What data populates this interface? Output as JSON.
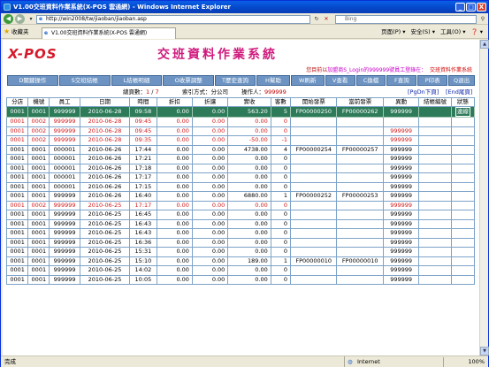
{
  "window": {
    "title": "V1.00交班資料作業系統(X-POS 雲通網) - Windows Internet Explorer"
  },
  "title_buttons": {
    "min": "_",
    "max": "□",
    "close": "X"
  },
  "address": {
    "url": "http://win2008/tw/jiaoban/jiaoban.asp",
    "search_text": "Bing"
  },
  "favorites": {
    "label": "收藏夹",
    "tab_title": "V1.00交班資料作業系統(X-POS 雲通網)",
    "commands": [
      "页面(P) ▾",
      "安全(S) ▾",
      "工具(O) ▾",
      "❓ ▾"
    ]
  },
  "app": {
    "logo": "X-POS",
    "title": "交班資料作業系統",
    "user_prefix": "您目前以",
    "user_name": "加盟商S_Login的999999號員工登錄在：",
    "user_function": "交班資料作業系統"
  },
  "menu": [
    "D關鍵操作",
    "S交班結帳",
    "L結帳明細",
    "O收票調整",
    "T歷史查詢",
    "H幫助",
    "W刷新",
    "V查看",
    "C換檔",
    "F查詢",
    "P印表",
    "Q退出"
  ],
  "info": {
    "pages_label": "總頁數：",
    "page_current": "1",
    "page_total": "7",
    "method_label": "索引方式：分公司",
    "operator_label": "操作人：",
    "operator_value": "999999",
    "pgdn": "[PgDn下頁]",
    "end": "[End尾頁]"
  },
  "table": {
    "headers": [
      "分店",
      "機號",
      "員工",
      "日期",
      "時間",
      "折扣",
      "折讓",
      "實收",
      "客數",
      "開始發票",
      "當前發票",
      "異動",
      "結帳編號",
      "狀態"
    ],
    "rows": [
      [
        "0001",
        "0001",
        "999999",
        "2010-06-28",
        "09:58",
        "0.00",
        "0.00",
        "563.20",
        "5",
        "FP00000250",
        "FP00000262",
        "999999",
        "",
        "連線"
      ],
      [
        "0001",
        "0002",
        "999999",
        "2010-06-28",
        "09:45",
        "0.00",
        "0.00",
        "0.00",
        "0",
        "",
        "",
        "",
        "",
        ""
      ],
      [
        "0001",
        "0002",
        "999999",
        "2010-06-28",
        "09:45",
        "0.00",
        "0.00",
        "0.00",
        "0",
        "",
        "",
        "999999",
        "",
        ""
      ],
      [
        "0001",
        "0002",
        "999999",
        "2010-06-28",
        "09:35",
        "0.00",
        "0.00",
        "-50.00",
        "-1",
        "",
        "",
        "999999",
        "",
        ""
      ],
      [
        "0001",
        "0001",
        "000001",
        "2010-06-26",
        "17:44",
        "0.00",
        "0.00",
        "4738.00",
        "4",
        "FP00000254",
        "FP00000257",
        "999999",
        "",
        ""
      ],
      [
        "0001",
        "0001",
        "000001",
        "2010-06-26",
        "17:21",
        "0.00",
        "0.00",
        "0.00",
        "0",
        "",
        "",
        "999999",
        "",
        ""
      ],
      [
        "0001",
        "0001",
        "000001",
        "2010-06-26",
        "17:18",
        "0.00",
        "0.00",
        "0.00",
        "0",
        "",
        "",
        "999999",
        "",
        ""
      ],
      [
        "0001",
        "0001",
        "000001",
        "2010-06-26",
        "17:17",
        "0.00",
        "0.00",
        "0.00",
        "0",
        "",
        "",
        "999999",
        "",
        ""
      ],
      [
        "0001",
        "0001",
        "000001",
        "2010-06-26",
        "17:15",
        "0.00",
        "0.00",
        "0.00",
        "0",
        "",
        "",
        "999999",
        "",
        ""
      ],
      [
        "0001",
        "0001",
        "999999",
        "2010-06-26",
        "16:40",
        "0.00",
        "0.00",
        "6880.00",
        "1",
        "FP00000252",
        "FP00000253",
        "999999",
        "",
        ""
      ],
      [
        "0001",
        "0002",
        "999999",
        "2010-06-25",
        "17:17",
        "0.00",
        "0.00",
        "0.00",
        "0",
        "",
        "",
        "999999",
        "",
        ""
      ],
      [
        "0001",
        "0001",
        "999999",
        "2010-06-25",
        "16:45",
        "0.00",
        "0.00",
        "0.00",
        "0",
        "",
        "",
        "999999",
        "",
        ""
      ],
      [
        "0001",
        "0001",
        "999999",
        "2010-06-25",
        "16:43",
        "0.00",
        "0.00",
        "0.00",
        "0",
        "",
        "",
        "999999",
        "",
        ""
      ],
      [
        "0001",
        "0001",
        "999999",
        "2010-06-25",
        "16:43",
        "0.00",
        "0.00",
        "0.00",
        "0",
        "",
        "",
        "999999",
        "",
        ""
      ],
      [
        "0001",
        "0001",
        "999999",
        "2010-06-25",
        "16:36",
        "0.00",
        "0.00",
        "0.00",
        "0",
        "",
        "",
        "999999",
        "",
        ""
      ],
      [
        "0001",
        "0001",
        "999999",
        "2010-06-25",
        "15:31",
        "0.00",
        "0.00",
        "0.00",
        "0",
        "",
        "",
        "999999",
        "",
        ""
      ],
      [
        "0001",
        "0001",
        "999999",
        "2010-06-25",
        "15:10",
        "0.00",
        "0.00",
        "189.00",
        "1",
        "FP00000010",
        "FP00000010",
        "999999",
        "",
        ""
      ],
      [
        "0001",
        "0001",
        "999999",
        "2010-06-25",
        "14:02",
        "0.00",
        "0.00",
        "0.00",
        "0",
        "",
        "",
        "999999",
        "",
        ""
      ],
      [
        "0001",
        "0001",
        "999999",
        "2010-06-25",
        "10:05",
        "0.00",
        "0.00",
        "0.00",
        "0",
        "",
        "",
        "999999",
        "",
        ""
      ]
    ],
    "row_styles": [
      "sel",
      "red",
      "red",
      "red",
      "blk",
      "blk",
      "blk",
      "blk",
      "blk",
      "blk",
      "red",
      "blk",
      "blk",
      "blk",
      "blk",
      "blk",
      "blk",
      "blk",
      "blk"
    ]
  },
  "status": {
    "done": "完成",
    "zone": "Internet",
    "zoom": "100%"
  }
}
